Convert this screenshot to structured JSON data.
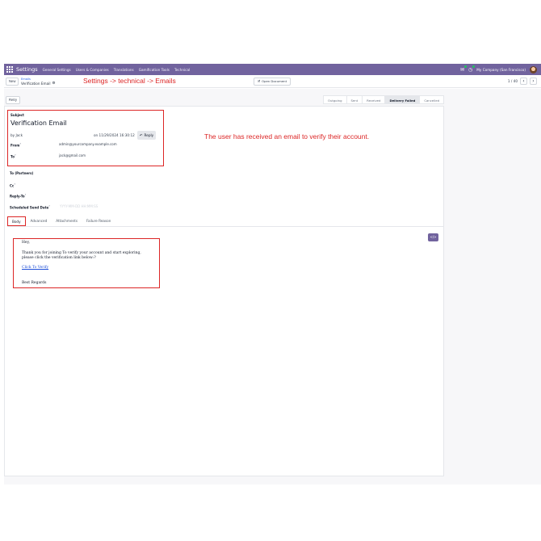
{
  "navbar": {
    "brand": "Settings",
    "menu": [
      "General Settings",
      "Users & Companies",
      "Translations",
      "Gamification Tools",
      "Technical"
    ],
    "company": "My Company (San Francisco)"
  },
  "control": {
    "new_label": "New",
    "breadcrumb_parent": "Emails",
    "breadcrumb_current": "Verification Email",
    "open_document_label": "Open Document",
    "pager": "1 / 40",
    "annotation": "Settings -> technical -> Emails"
  },
  "statusbar": {
    "retry_label": "Retry",
    "steps": [
      "Outgoing",
      "Sent",
      "Received",
      "Delivery Failed",
      "Cancelled"
    ]
  },
  "mail": {
    "subject_label": "Subject",
    "subject": "Verification Email",
    "by": "by  Jack",
    "date": "on 11/29/2024 16:30:12",
    "reply_label": "Reply",
    "from_label": "From",
    "from_value": "admin@yourcompany.example.com",
    "to_label": "To",
    "to_value": "jack@gmail.com",
    "annotation": "The user has received an email to verify their account."
  },
  "fields": {
    "partners_label": "To (Partners)",
    "cc_label": "Cc",
    "reply_to_label": "Reply-To",
    "scheduled_label": "Scheduled Send Date",
    "scheduled_placeholder": "YYYY-MM-DD HH:MM:SS"
  },
  "tabs": [
    "Body",
    "Advanced",
    "Attachments",
    "Failure Reason"
  ],
  "body": {
    "greeting": "Hey,",
    "line1": "Thank you for joining To verify your account and start exploring,",
    "line2": "please click the verification link below:?",
    "link": "Click To Verify",
    "closing": "Best Regards",
    "code_button": "</>"
  },
  "colors": {
    "brand": "#71639e",
    "annotation": "#dc2626",
    "link": "#1d4ed8"
  }
}
